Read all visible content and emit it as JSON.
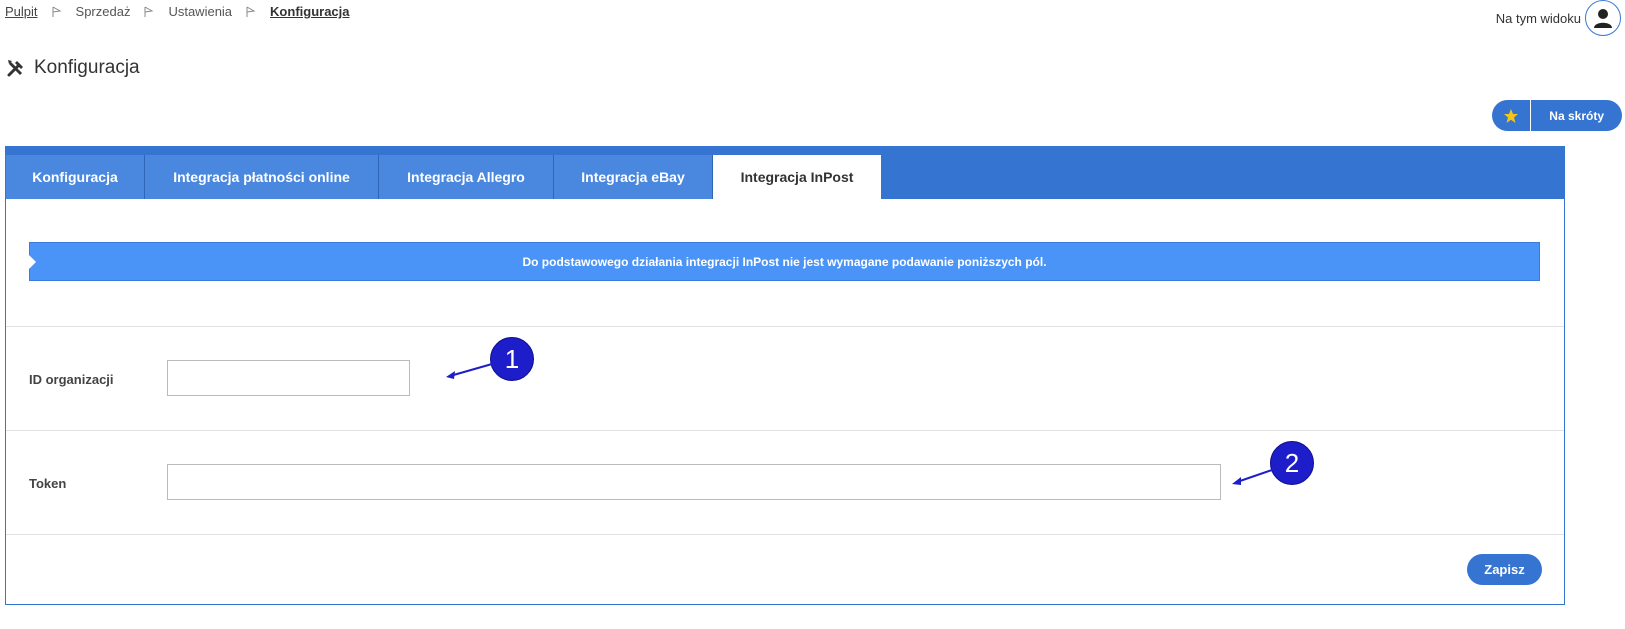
{
  "breadcrumb": {
    "items": [
      "Pulpit",
      "Sprzedaż",
      "Ustawienia",
      "Konfiguracja"
    ]
  },
  "header": {
    "view_label": "Na tym widoku",
    "title": "Konfiguracja",
    "shortcut_label": "Na skróty"
  },
  "tabs": [
    {
      "label": "Konfiguracja",
      "active": false
    },
    {
      "label": "Integracja płatności online",
      "active": false
    },
    {
      "label": "Integracja Allegro",
      "active": false
    },
    {
      "label": "Integracja eBay",
      "active": false
    },
    {
      "label": "Integracja InPost",
      "active": true
    }
  ],
  "alert": {
    "text": "Do podstawowego działania integracji InPost nie jest wymagane podawanie poniższych pól."
  },
  "form": {
    "org_id": {
      "label": "ID organizacji",
      "value": ""
    },
    "token": {
      "label": "Token",
      "value": ""
    },
    "save_label": "Zapisz"
  },
  "annotations": {
    "marker1": "1",
    "marker2": "2"
  },
  "colors": {
    "primary": "#3574d0",
    "alert": "#4b94f7",
    "marker": "#1d1dc9",
    "star": "#f5c518"
  }
}
